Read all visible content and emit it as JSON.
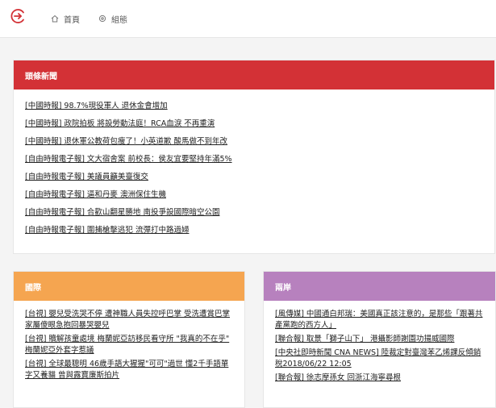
{
  "nav": {
    "home_label": "首頁",
    "settings_label": "組態"
  },
  "colors": {
    "accent_red": "#d33136",
    "accent_orange": "#f5a550",
    "accent_purple": "#b781be"
  },
  "headline": {
    "title": "頭條新聞",
    "items": [
      "[中國時報] 98.7%現役軍人 退休金會增加",
      "[中國時報] 政院拍板 將設勞動法庭！RCA血淚 不再重演",
      "[中國時報] 退休軍公教荷包瘦了！小英道歉 酸馬做不到年改",
      "[自由時報電子報] 文大宿舍案 前校長：侯友宜要堅持年滿5%",
      "[自由時報電子報] 美議員籲美臺復交",
      "[自由時報電子報] 逼和丹麥 澳洲保住生機",
      "[自由時報電子報] 合歡山翻星勝地 南投爭設國際暗空公園",
      "[自由時報電子報] 圍捕槍擊逃犯 流彈打中路過婦"
    ]
  },
  "international": {
    "title": "國際",
    "items": [
      "[台視] 嬰兒受洗哭不停 遭神職人員失控呼巴掌 受洗遭賞巴掌 家屬傻眼急抱回暴哭嬰兒",
      "[台視] 贖解孩童處境 梅蘭妮亞訪移民看守所 \"我真的不在乎\" 梅蘭妮亞外套字惹議",
      "[台視] 全球最聰明 46歲手語大猩猩\"可可\"過世 懂2千手語單字又養貓 曾與露寶廉斯拍片"
    ]
  },
  "cross_strait": {
    "title": "兩岸",
    "items": [
      "[風傳媒] 中國通白邦瑞：美國真正該注意的，是那些「跟著共產黨跑的西方人」",
      "[聯合報] 取景「獅子山下」 港攝影師謝園功揚威國際",
      "[中央社即時新聞 CNA NEWS] 陸裁定對臺灣苯乙烯課反傾銷稅2018/06/22 12:05",
      "[聯合報] 徐志摩孫女 回浙江海寧尋根"
    ]
  }
}
